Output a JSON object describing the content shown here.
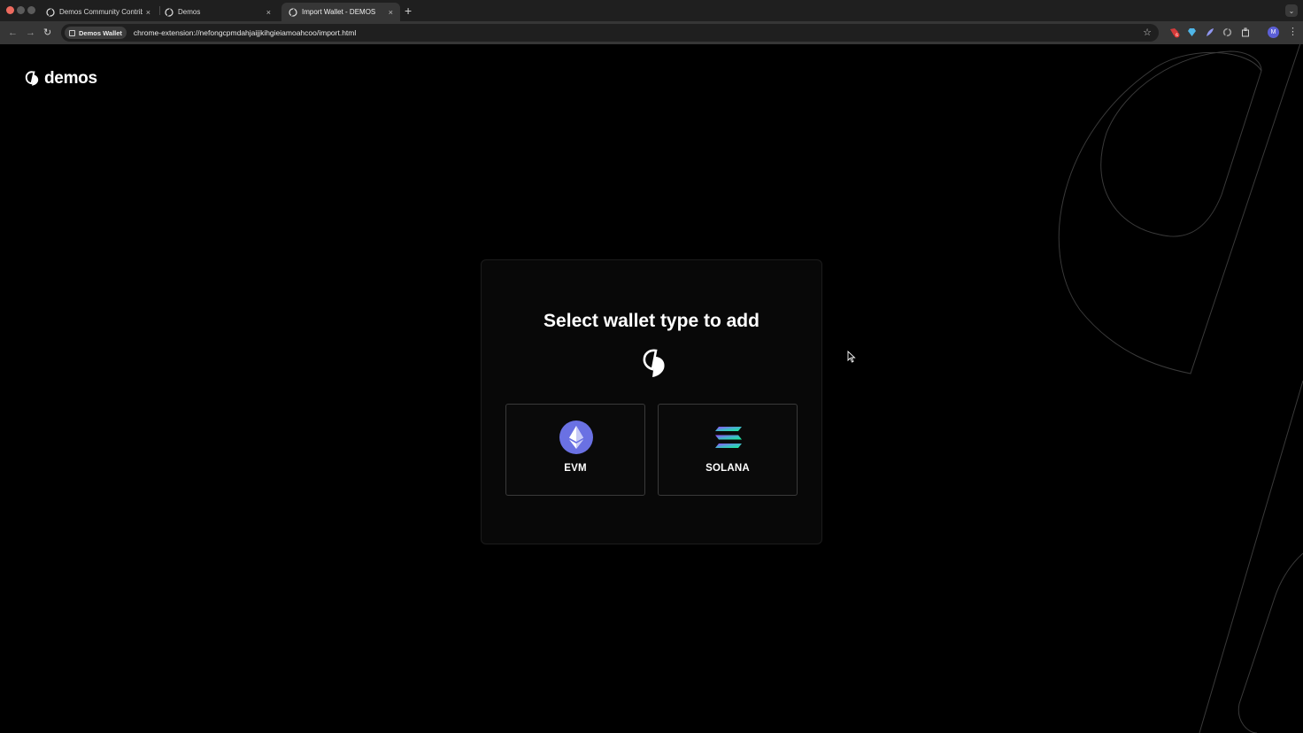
{
  "browser": {
    "tabs": [
      {
        "title": "Demos Community Contributi",
        "active": false
      },
      {
        "title": "Demos",
        "active": false
      },
      {
        "title": "Import Wallet - DEMOS",
        "active": true
      }
    ],
    "new_tab_label": "+",
    "close_label": "×",
    "site_chip": "Demos Wallet",
    "url": "chrome-extension://nefongcpmdahjaijjkihgieiamoahcoo/import.html",
    "profile_initial": "M",
    "extension_badge": "6"
  },
  "app": {
    "brand": "demos",
    "heading": "Select wallet type to add",
    "options": [
      {
        "label": "EVM",
        "icon": "ethereum-icon"
      },
      {
        "label": "SOLANA",
        "icon": "solana-icon"
      }
    ]
  },
  "colors": {
    "evm_circle": "#6a71e3",
    "solana_top": "#9945ff",
    "solana_bottom": "#14f195",
    "background": "#000000"
  }
}
